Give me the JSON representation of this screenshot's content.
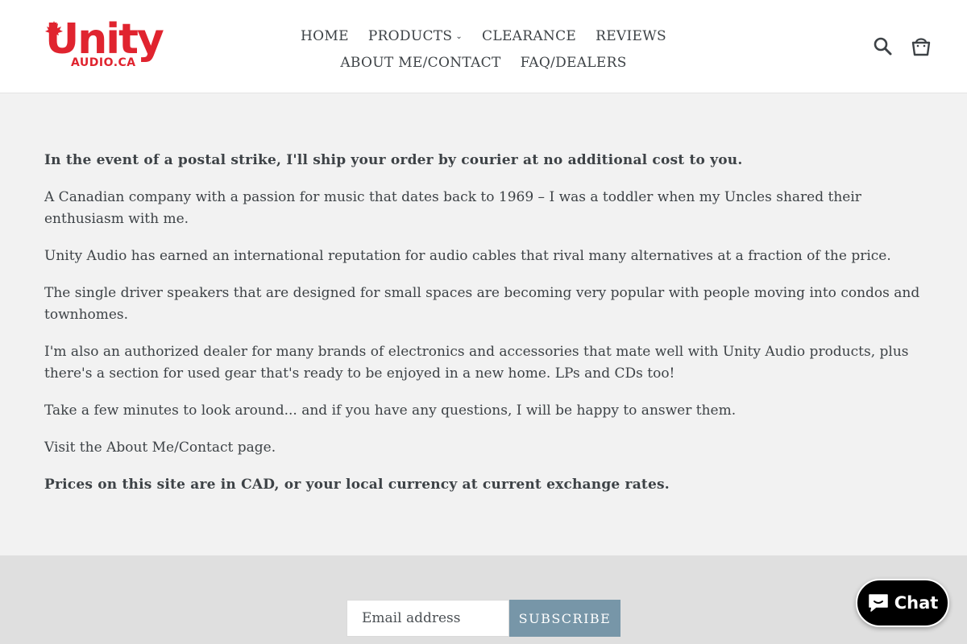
{
  "brand": {
    "name": "Unity",
    "subtitle": "AUDIO.CA",
    "color": "#e0242f"
  },
  "nav": {
    "row1": [
      "HOME",
      "PRODUCTS",
      "CLEARANCE",
      "REVIEWS"
    ],
    "row2": [
      "ABOUT ME/CONTACT",
      "FAQ/DEALERS"
    ],
    "products_has_dropdown": true
  },
  "header_icons": {
    "search": "search-icon",
    "cart": "cart-icon"
  },
  "content": {
    "paragraphs": [
      "In the event of a postal strike, I'll ship your order by courier at no additional cost to you.",
      "A Canadian company with a passion for music that dates back to 1969 – I was a toddler when my Uncles shared their enthusiasm with me.",
      "Unity Audio has earned an international reputation for audio cables that rival many alternatives at a fraction of the price.",
      "The single driver speakers that are designed for small spaces are becoming very popular with people moving into condos and townhomes.",
      "I'm also an authorized dealer for many brands of electronics and accessories that mate well with Unity Audio products, plus there's a section for used gear that's ready to be enjoyed in a new home. LPs and CDs too!",
      "Take a few minutes to look around... and if you have any questions, I will be happy to answer them.",
      "Visit the About Me/Contact page.",
      "Prices on this site are in CAD, or your local currency at current exchange rates."
    ]
  },
  "newsletter": {
    "email_placeholder": "Email address",
    "subscribe_label": "SUBSCRIBE",
    "button_color": "#7796a8"
  },
  "chat": {
    "label": "Chat",
    "icon": "chat-bubble-icon"
  }
}
